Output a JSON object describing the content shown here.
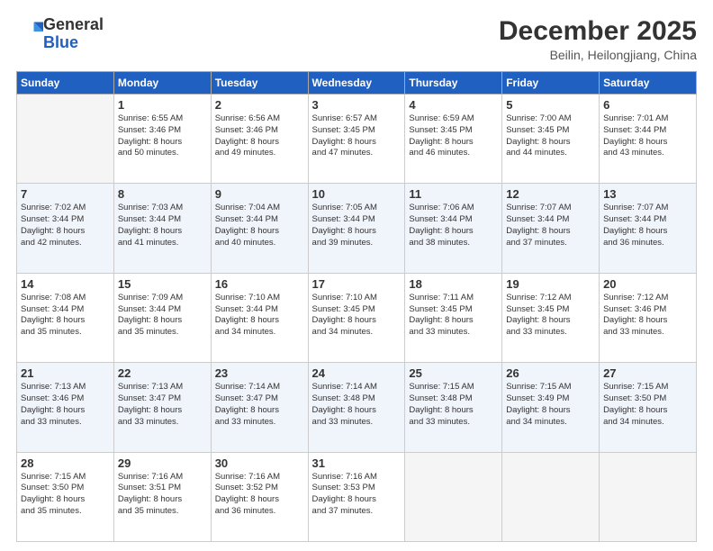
{
  "logo": {
    "general": "General",
    "blue": "Blue"
  },
  "header": {
    "month": "December 2025",
    "location": "Beilin, Heilongjiang, China"
  },
  "weekdays": [
    "Sunday",
    "Monday",
    "Tuesday",
    "Wednesday",
    "Thursday",
    "Friday",
    "Saturday"
  ],
  "weeks": [
    [
      {
        "day": "",
        "lines": []
      },
      {
        "day": "1",
        "lines": [
          "Sunrise: 6:55 AM",
          "Sunset: 3:46 PM",
          "Daylight: 8 hours",
          "and 50 minutes."
        ]
      },
      {
        "day": "2",
        "lines": [
          "Sunrise: 6:56 AM",
          "Sunset: 3:46 PM",
          "Daylight: 8 hours",
          "and 49 minutes."
        ]
      },
      {
        "day": "3",
        "lines": [
          "Sunrise: 6:57 AM",
          "Sunset: 3:45 PM",
          "Daylight: 8 hours",
          "and 47 minutes."
        ]
      },
      {
        "day": "4",
        "lines": [
          "Sunrise: 6:59 AM",
          "Sunset: 3:45 PM",
          "Daylight: 8 hours",
          "and 46 minutes."
        ]
      },
      {
        "day": "5",
        "lines": [
          "Sunrise: 7:00 AM",
          "Sunset: 3:45 PM",
          "Daylight: 8 hours",
          "and 44 minutes."
        ]
      },
      {
        "day": "6",
        "lines": [
          "Sunrise: 7:01 AM",
          "Sunset: 3:44 PM",
          "Daylight: 8 hours",
          "and 43 minutes."
        ]
      }
    ],
    [
      {
        "day": "7",
        "lines": [
          "Sunrise: 7:02 AM",
          "Sunset: 3:44 PM",
          "Daylight: 8 hours",
          "and 42 minutes."
        ]
      },
      {
        "day": "8",
        "lines": [
          "Sunrise: 7:03 AM",
          "Sunset: 3:44 PM",
          "Daylight: 8 hours",
          "and 41 minutes."
        ]
      },
      {
        "day": "9",
        "lines": [
          "Sunrise: 7:04 AM",
          "Sunset: 3:44 PM",
          "Daylight: 8 hours",
          "and 40 minutes."
        ]
      },
      {
        "day": "10",
        "lines": [
          "Sunrise: 7:05 AM",
          "Sunset: 3:44 PM",
          "Daylight: 8 hours",
          "and 39 minutes."
        ]
      },
      {
        "day": "11",
        "lines": [
          "Sunrise: 7:06 AM",
          "Sunset: 3:44 PM",
          "Daylight: 8 hours",
          "and 38 minutes."
        ]
      },
      {
        "day": "12",
        "lines": [
          "Sunrise: 7:07 AM",
          "Sunset: 3:44 PM",
          "Daylight: 8 hours",
          "and 37 minutes."
        ]
      },
      {
        "day": "13",
        "lines": [
          "Sunrise: 7:07 AM",
          "Sunset: 3:44 PM",
          "Daylight: 8 hours",
          "and 36 minutes."
        ]
      }
    ],
    [
      {
        "day": "14",
        "lines": [
          "Sunrise: 7:08 AM",
          "Sunset: 3:44 PM",
          "Daylight: 8 hours",
          "and 35 minutes."
        ]
      },
      {
        "day": "15",
        "lines": [
          "Sunrise: 7:09 AM",
          "Sunset: 3:44 PM",
          "Daylight: 8 hours",
          "and 35 minutes."
        ]
      },
      {
        "day": "16",
        "lines": [
          "Sunrise: 7:10 AM",
          "Sunset: 3:44 PM",
          "Daylight: 8 hours",
          "and 34 minutes."
        ]
      },
      {
        "day": "17",
        "lines": [
          "Sunrise: 7:10 AM",
          "Sunset: 3:45 PM",
          "Daylight: 8 hours",
          "and 34 minutes."
        ]
      },
      {
        "day": "18",
        "lines": [
          "Sunrise: 7:11 AM",
          "Sunset: 3:45 PM",
          "Daylight: 8 hours",
          "and 33 minutes."
        ]
      },
      {
        "day": "19",
        "lines": [
          "Sunrise: 7:12 AM",
          "Sunset: 3:45 PM",
          "Daylight: 8 hours",
          "and 33 minutes."
        ]
      },
      {
        "day": "20",
        "lines": [
          "Sunrise: 7:12 AM",
          "Sunset: 3:46 PM",
          "Daylight: 8 hours",
          "and 33 minutes."
        ]
      }
    ],
    [
      {
        "day": "21",
        "lines": [
          "Sunrise: 7:13 AM",
          "Sunset: 3:46 PM",
          "Daylight: 8 hours",
          "and 33 minutes."
        ]
      },
      {
        "day": "22",
        "lines": [
          "Sunrise: 7:13 AM",
          "Sunset: 3:47 PM",
          "Daylight: 8 hours",
          "and 33 minutes."
        ]
      },
      {
        "day": "23",
        "lines": [
          "Sunrise: 7:14 AM",
          "Sunset: 3:47 PM",
          "Daylight: 8 hours",
          "and 33 minutes."
        ]
      },
      {
        "day": "24",
        "lines": [
          "Sunrise: 7:14 AM",
          "Sunset: 3:48 PM",
          "Daylight: 8 hours",
          "and 33 minutes."
        ]
      },
      {
        "day": "25",
        "lines": [
          "Sunrise: 7:15 AM",
          "Sunset: 3:48 PM",
          "Daylight: 8 hours",
          "and 33 minutes."
        ]
      },
      {
        "day": "26",
        "lines": [
          "Sunrise: 7:15 AM",
          "Sunset: 3:49 PM",
          "Daylight: 8 hours",
          "and 34 minutes."
        ]
      },
      {
        "day": "27",
        "lines": [
          "Sunrise: 7:15 AM",
          "Sunset: 3:50 PM",
          "Daylight: 8 hours",
          "and 34 minutes."
        ]
      }
    ],
    [
      {
        "day": "28",
        "lines": [
          "Sunrise: 7:15 AM",
          "Sunset: 3:50 PM",
          "Daylight: 8 hours",
          "and 35 minutes."
        ]
      },
      {
        "day": "29",
        "lines": [
          "Sunrise: 7:16 AM",
          "Sunset: 3:51 PM",
          "Daylight: 8 hours",
          "and 35 minutes."
        ]
      },
      {
        "day": "30",
        "lines": [
          "Sunrise: 7:16 AM",
          "Sunset: 3:52 PM",
          "Daylight: 8 hours",
          "and 36 minutes."
        ]
      },
      {
        "day": "31",
        "lines": [
          "Sunrise: 7:16 AM",
          "Sunset: 3:53 PM",
          "Daylight: 8 hours",
          "and 37 minutes."
        ]
      },
      {
        "day": "",
        "lines": []
      },
      {
        "day": "",
        "lines": []
      },
      {
        "day": "",
        "lines": []
      }
    ]
  ]
}
